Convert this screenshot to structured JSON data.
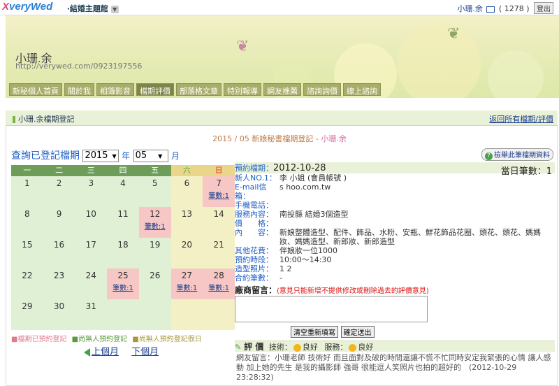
{
  "topbar": {
    "logo_x": "X",
    "logo_rest": "veryWed",
    "theme_menu": "‧結婚主題館",
    "user_name": "小珊.余",
    "mail_count": "( 1278 )",
    "logout": "登出"
  },
  "banner": {
    "name": "小珊.余",
    "url": "http://verywed.com/0923197556"
  },
  "nav": [
    "新秘個人首頁",
    "關於我",
    "相簿影音",
    "檔期評價",
    "部落格文章",
    "特別報導",
    "網友推薦",
    "諮詢詢價",
    "線上諮詢"
  ],
  "section": {
    "title": "小珊.余檔期登記",
    "back_link": "返回所有檔期/評價"
  },
  "page_title": {
    "prefix": "2015 / 05 新娘秘書檔期登記 - ",
    "name": "小珊.余"
  },
  "query": {
    "label": "查詢已登記檔期",
    "year": "2015",
    "year_unit": "年",
    "month": "05",
    "month_unit": "月"
  },
  "help_button": "檢舉此筆檔期資料",
  "calendar": {
    "weekdays": [
      "一",
      "二",
      "三",
      "四",
      "五",
      "六",
      "日"
    ],
    "count_label": "筆數:1",
    "rows": [
      [
        {
          "d": "1"
        },
        {
          "d": "2"
        },
        {
          "d": "3"
        },
        {
          "d": "4"
        },
        {
          "d": "5"
        },
        {
          "d": "6"
        },
        {
          "d": "7",
          "b": true
        }
      ],
      [
        {
          "d": "8"
        },
        {
          "d": "9"
        },
        {
          "d": "10"
        },
        {
          "d": "11"
        },
        {
          "d": "12",
          "b": true
        },
        {
          "d": "13"
        },
        {
          "d": "14"
        }
      ],
      [
        {
          "d": "15"
        },
        {
          "d": "16"
        },
        {
          "d": "17"
        },
        {
          "d": "18"
        },
        {
          "d": "19"
        },
        {
          "d": "20"
        },
        {
          "d": "21"
        }
      ],
      [
        {
          "d": "22"
        },
        {
          "d": "23"
        },
        {
          "d": "24"
        },
        {
          "d": "25",
          "b": true
        },
        {
          "d": "26"
        },
        {
          "d": "27",
          "b": true
        },
        {
          "d": "28",
          "b": true
        }
      ],
      [
        {
          "d": "29"
        },
        {
          "d": "30"
        },
        {
          "d": "31"
        },
        {
          "d": ""
        },
        {
          "d": ""
        },
        {
          "d": ""
        },
        {
          "d": ""
        }
      ]
    ]
  },
  "legend": [
    "■檔期已預約登記",
    "■尚無人預約登記",
    "■尚無人預約登記假日"
  ],
  "pager": {
    "prev": "上個月",
    "next": "下個月"
  },
  "detail": {
    "date_label": "預約檔期：",
    "date_value": "2012-10-28",
    "count_label": "當日筆數：",
    "count_value": "1",
    "fields": [
      {
        "k": "新人NO.1：",
        "v": "李     小姐 (會員帳號            )"
      },
      {
        "k": "E-mail信箱：",
        "v": "s              hoo.com.tw"
      },
      {
        "k": "手機電話：",
        "v": ""
      },
      {
        "k": "服務內容：",
        "v": "南投縣 結婚3個造型"
      },
      {
        "k": "價　　格：",
        "v": ""
      },
      {
        "k": "內　　容：",
        "v": "新娘整體造型、配件、飾品、水粉、安瓶、鮮花飾品花圈、頭花、頭花、媽媽妝、媽媽造型、新郎妝、新郎造型"
      },
      {
        "k": "其他花費：",
        "v": "伴娘妝一位1000"
      },
      {
        "k": "預約時段：",
        "v": "10:00〜14:30"
      },
      {
        "k": "造型照片：",
        "v": "1  2"
      },
      {
        "k": "合約筆數：",
        "v": "-"
      }
    ],
    "message_title": "廠商留言：",
    "message_warn": "(意見只能新增不提供修改或刪除過去的評價意見)",
    "btn_reset": "清空重新填寫",
    "btn_submit": "確定送出",
    "eval_title": "評 價",
    "eval_skill": "技術：",
    "eval_skill_val": "良好",
    "eval_service": "服務：",
    "eval_service_val": "良好",
    "review": "網友留言：小珊老師 技術好 而且面對及破的時間還讓不慌不忙同時安定我緊張的心情 讓人感動 加上她的先生 是我的攝影師 強哥 很能逗人笑照片也拍的超好的　(2012-10-29 23:28:32)"
  }
}
